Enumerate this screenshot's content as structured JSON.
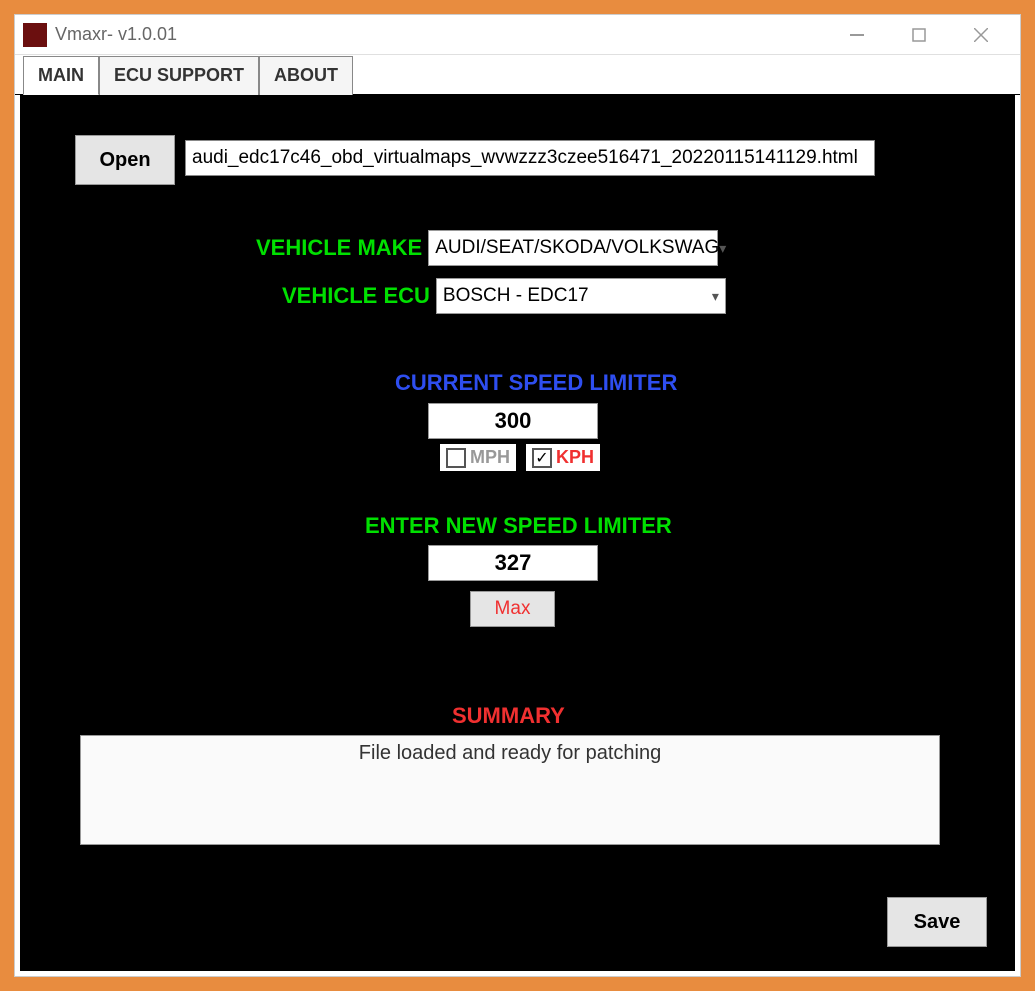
{
  "window": {
    "title": "Vmaxr- v1.0.01"
  },
  "tabs": {
    "main": "MAIN",
    "ecu": "ECU SUPPORT",
    "about": "ABOUT"
  },
  "open_button": "Open",
  "filepath": "audi_edc17c46_obd_virtualmaps_wvwzzz3czee516471_20220115141129.html",
  "labels": {
    "vehicle_make": "VEHICLE MAKE",
    "vehicle_ecu": "VEHICLE ECU",
    "current_limiter": "CURRENT SPEED LIMITER",
    "new_limiter": "ENTER NEW SPEED LIMITER",
    "summary": "SUMMARY"
  },
  "vehicle_make_value": "AUDI/SEAT/SKODA/VOLKSWAG",
  "vehicle_ecu_value": "BOSCH - EDC17",
  "current_speed": "300",
  "units": {
    "mph_label": "MPH",
    "mph_checked": false,
    "kph_label": "KPH",
    "kph_checked": true
  },
  "new_speed": "327",
  "max_button": "Max",
  "summary_text": "File loaded and ready for patching",
  "save_button": "Save"
}
